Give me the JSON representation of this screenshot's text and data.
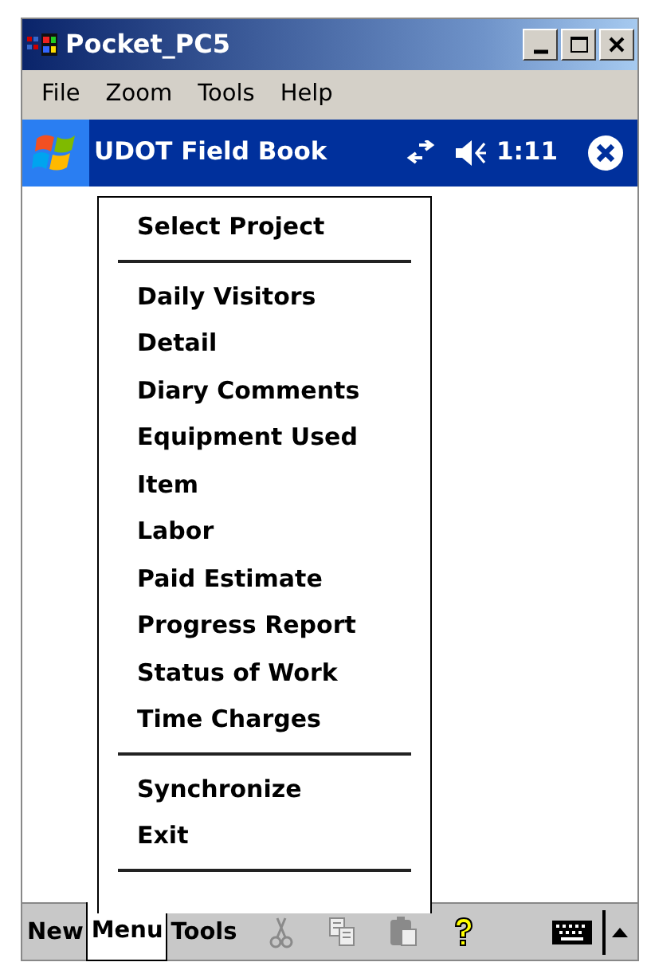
{
  "window": {
    "title": "Pocket_PC5"
  },
  "menu_bar": [
    {
      "label": "File"
    },
    {
      "label": "Zoom"
    },
    {
      "label": "Tools"
    },
    {
      "label": "Help"
    }
  ],
  "nav_bar": {
    "title": "UDOT Field Book",
    "time": "1:11"
  },
  "popup_menu": [
    {
      "kind": "item",
      "label": "Select Project"
    },
    {
      "kind": "separator"
    },
    {
      "kind": "item",
      "label": "Daily Visitors"
    },
    {
      "kind": "item",
      "label": "Detail"
    },
    {
      "kind": "item",
      "label": "Diary Comments"
    },
    {
      "kind": "item",
      "label": "Equipment Used"
    },
    {
      "kind": "item",
      "label": "Item"
    },
    {
      "kind": "item",
      "label": "Labor"
    },
    {
      "kind": "item",
      "label": "Paid Estimate"
    },
    {
      "kind": "item",
      "label": "Progress Report"
    },
    {
      "kind": "item",
      "label": "Status of Work"
    },
    {
      "kind": "item",
      "label": "Time Charges"
    },
    {
      "kind": "separator"
    },
    {
      "kind": "item",
      "label": "Synchronize"
    },
    {
      "kind": "item",
      "label": "Exit"
    },
    {
      "kind": "separator"
    }
  ],
  "soft_keys": [
    {
      "label": "New",
      "selected": false
    },
    {
      "label": "Menu",
      "selected": true
    },
    {
      "label": "Tools",
      "selected": false
    }
  ],
  "toolbar": [
    {
      "kind": "cut",
      "disabled": true
    },
    {
      "kind": "copy",
      "disabled": true
    },
    {
      "kind": "paste",
      "disabled": true
    },
    {
      "kind": "help",
      "disabled": false
    }
  ]
}
